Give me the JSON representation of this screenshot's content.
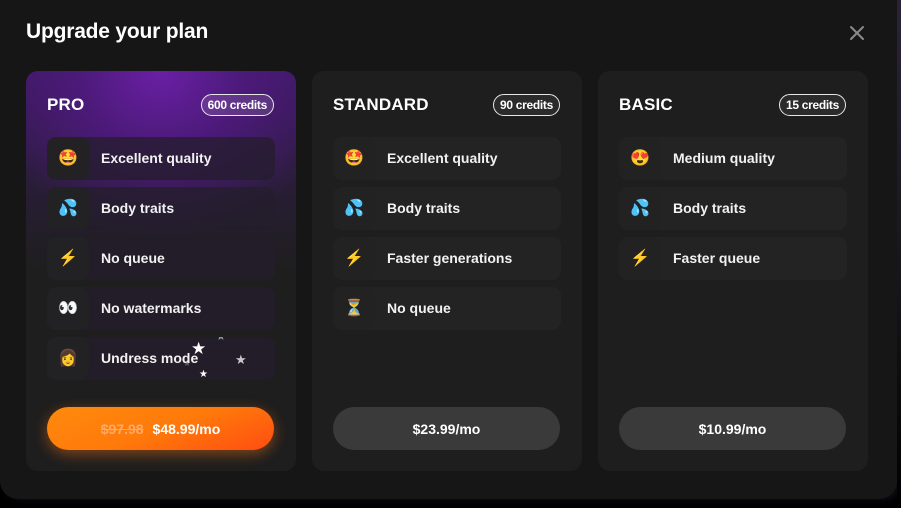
{
  "dialog": {
    "title": "Upgrade your plan",
    "close_icon": "close-icon"
  },
  "plans": [
    {
      "name": "PRO",
      "credits": "600 credits",
      "features": [
        {
          "icon": "star-struck-face-icon",
          "emoji": "🤩",
          "label": "Excellent quality"
        },
        {
          "icon": "sweat-droplets-icon",
          "emoji": "💦",
          "label": "Body traits"
        },
        {
          "icon": "lightning-icon",
          "emoji": "⚡",
          "label": "No queue"
        },
        {
          "icon": "eyes-icon",
          "emoji": "👀",
          "label": "No watermarks"
        },
        {
          "icon": "woman-icon",
          "emoji": "👩",
          "label": "Undress mode"
        }
      ],
      "old_price": "$97.98",
      "price": "$48.99/mo",
      "accent_color": "#ff7a0a"
    },
    {
      "name": "STANDARD",
      "credits": "90 credits",
      "features": [
        {
          "icon": "star-struck-face-icon",
          "emoji": "🤩",
          "label": "Excellent quality"
        },
        {
          "icon": "sweat-droplets-icon",
          "emoji": "💦",
          "label": "Body traits"
        },
        {
          "icon": "lightning-icon",
          "emoji": "⚡",
          "label": "Faster generations"
        },
        {
          "icon": "hourglass-icon",
          "emoji": "⏳",
          "label": "No queue"
        }
      ],
      "price": "$23.99/mo"
    },
    {
      "name": "BASIC",
      "credits": "15 credits",
      "features": [
        {
          "icon": "heart-eyes-face-icon",
          "emoji": "😍",
          "label": "Medium quality"
        },
        {
          "icon": "sweat-droplets-icon",
          "emoji": "💦",
          "label": "Body traits"
        },
        {
          "icon": "lightning-icon",
          "emoji": "⚡",
          "label": "Faster queue"
        }
      ],
      "price": "$10.99/mo"
    }
  ],
  "colors": {
    "pro_gradient_top": "#6a1fa5",
    "card_bg": "#1e1e1e",
    "modal_bg": "#161616",
    "price_button_bg": "#3a3a3a",
    "pro_button_orange": "#ff8a0d",
    "pro_button_red": "#ff4d12"
  }
}
